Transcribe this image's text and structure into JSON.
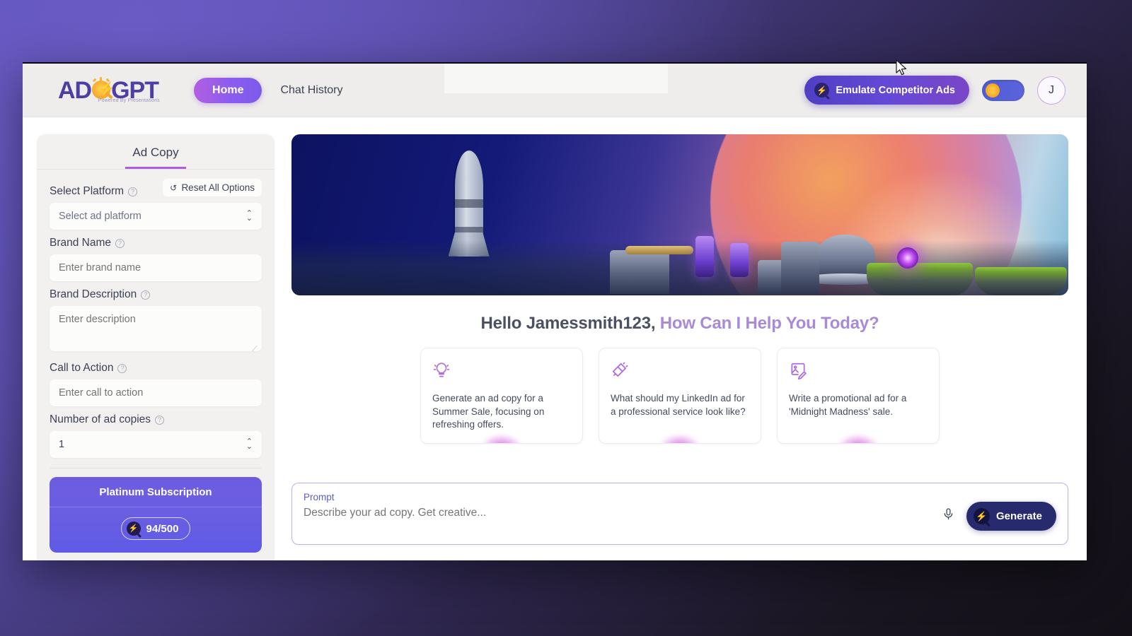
{
  "topbar": {
    "logo": {
      "text_left": "AD",
      "text_right": "GPT",
      "tagline": "Powered By Presentations",
      "icon": "sun-magnifier-bolt-icon"
    },
    "nav": [
      {
        "label": "Home",
        "active": true
      },
      {
        "label": "Chat History",
        "active": false
      }
    ],
    "emulate_button": {
      "label": "Emulate Competitor Ads",
      "icon": "bolt-search-icon"
    },
    "theme_toggle": {
      "icon": "sun-icon",
      "state": "light"
    },
    "avatar": {
      "initial": "J"
    }
  },
  "sidebar": {
    "tabs": [
      {
        "label": "Ad Copy",
        "active": true
      }
    ],
    "reset_button": {
      "label": "Reset All Options",
      "icon": "reset-icon"
    },
    "fields": [
      {
        "label": "Select Platform",
        "help": "?",
        "type": "select",
        "value": "Select ad platform",
        "icon": "chevron-updown-icon"
      },
      {
        "label": "Brand Name",
        "help": "?",
        "type": "input",
        "placeholder": "Enter brand name"
      },
      {
        "label": "Brand Description",
        "help": "?",
        "type": "textarea",
        "placeholder": "Enter description"
      },
      {
        "label": "Call to Action",
        "help": "?",
        "type": "input",
        "placeholder": "Enter call to action"
      },
      {
        "label": "Number of ad copies",
        "help": "?",
        "type": "stepper",
        "value": "1",
        "icon": "chevron-updown-icon"
      }
    ],
    "subscription": {
      "title": "Platinum Subscription",
      "credits": "94/500",
      "icon": "credit-coin-icon"
    }
  },
  "main": {
    "banner": {
      "alt": "sci-fi space colony with rocket and planet"
    },
    "greeting": {
      "part1": "Hello Jamessmith123,",
      "part2": "How Can I Help You Today?"
    },
    "suggestion_cards": [
      {
        "icon": "lightbulb-icon",
        "text": "Generate an ad copy for a Summer Sale, focusing on refreshing offers."
      },
      {
        "icon": "megaphone-icon",
        "text": "What should my LinkedIn ad for a professional service look like?"
      },
      {
        "icon": "image-edit-icon",
        "text": "Write a promotional ad for a 'Midnight Madness' sale."
      }
    ],
    "prompt": {
      "label": "Prompt",
      "placeholder": "Describe your ad copy. Get creative...",
      "value": "",
      "mic_icon": "microphone-icon",
      "generate_button": {
        "label": "Generate",
        "icon": "bolt-search-icon"
      }
    }
  },
  "colors": {
    "accent_purple": "#b05ae0",
    "brand_indigo": "#4b3fa6",
    "button_navy": "#282a6e",
    "subscription_gradient_start": "#6d5ce0",
    "page_background": "#53489f"
  }
}
